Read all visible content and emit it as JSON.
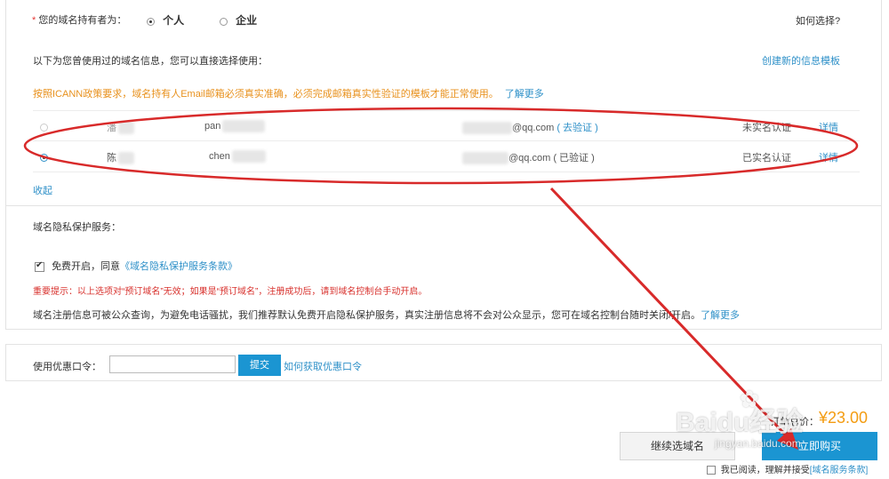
{
  "owner": {
    "required_mark": "*",
    "label": "您的域名持有者为：",
    "options": [
      {
        "label": "个人",
        "selected": true
      },
      {
        "label": "企业",
        "selected": false
      }
    ],
    "help_link": "如何选择?"
  },
  "used_info": {
    "text": "以下为您曾使用过的域名信息，您可以直接选择使用：",
    "create_link": "创建新的信息模板"
  },
  "icann": {
    "notice": "按照ICANN政策要求，域名持有人Email邮箱必须真实准确，必须完成邮箱真实性验证的模板才能正常使用。",
    "more_link": "了解更多"
  },
  "contacts": [
    {
      "name_visible": "潘",
      "pinyin_visible": "pan",
      "email_suffix": "@qq.com",
      "verify_text": "( 去验证 )",
      "status": "未实名认证",
      "detail_link": "详情",
      "selected": false
    },
    {
      "name_visible": "陈",
      "pinyin_visible": "chen",
      "email_suffix": "@qq.com",
      "verify_text": "( 已验证 )",
      "status": "已实名认证",
      "detail_link": "详情",
      "selected": true
    }
  ],
  "collapse_link": "收起",
  "privacy": {
    "title": "域名隐私保护服务：",
    "checkbox_checked": true,
    "checkbox_label": "免费开启，同意",
    "terms_link": "《域名隐私保护服务条款》",
    "warning": "重要提示：以上选项对“预订域名”无效；如果是“预订域名”，注册成功后，请到域名控制台手动开启。",
    "description": "域名注册信息可被公众查询，为避免电话骚扰，我们推荐默认免费开启隐私保护服务，真实注册信息将不会对公众显示，您可在域名控制台随时关闭/开启。",
    "more_link": "了解更多"
  },
  "coupon": {
    "label": "使用优惠口令：",
    "value": "",
    "submit": "提交",
    "help_link": "如何获取优惠口令"
  },
  "order": {
    "total_label": "订单总价：",
    "total_value": "¥23.00",
    "continue_button": "继续选域名",
    "buy_button": "立即购买",
    "agree_text": "我已阅读，理解并接受",
    "agree_link": "[域名服务条款]",
    "agree_checked": false
  },
  "watermark": {
    "brand": "Baidu经验",
    "url": "jingyan.baidu.com"
  },
  "colors": {
    "accent": "#2e90c8",
    "button_blue": "#1b95d2",
    "warning_orange": "#e8911d",
    "warning_red": "#d8322e",
    "price_orange": "#f39c12",
    "annotation_red": "#d82a2a"
  }
}
